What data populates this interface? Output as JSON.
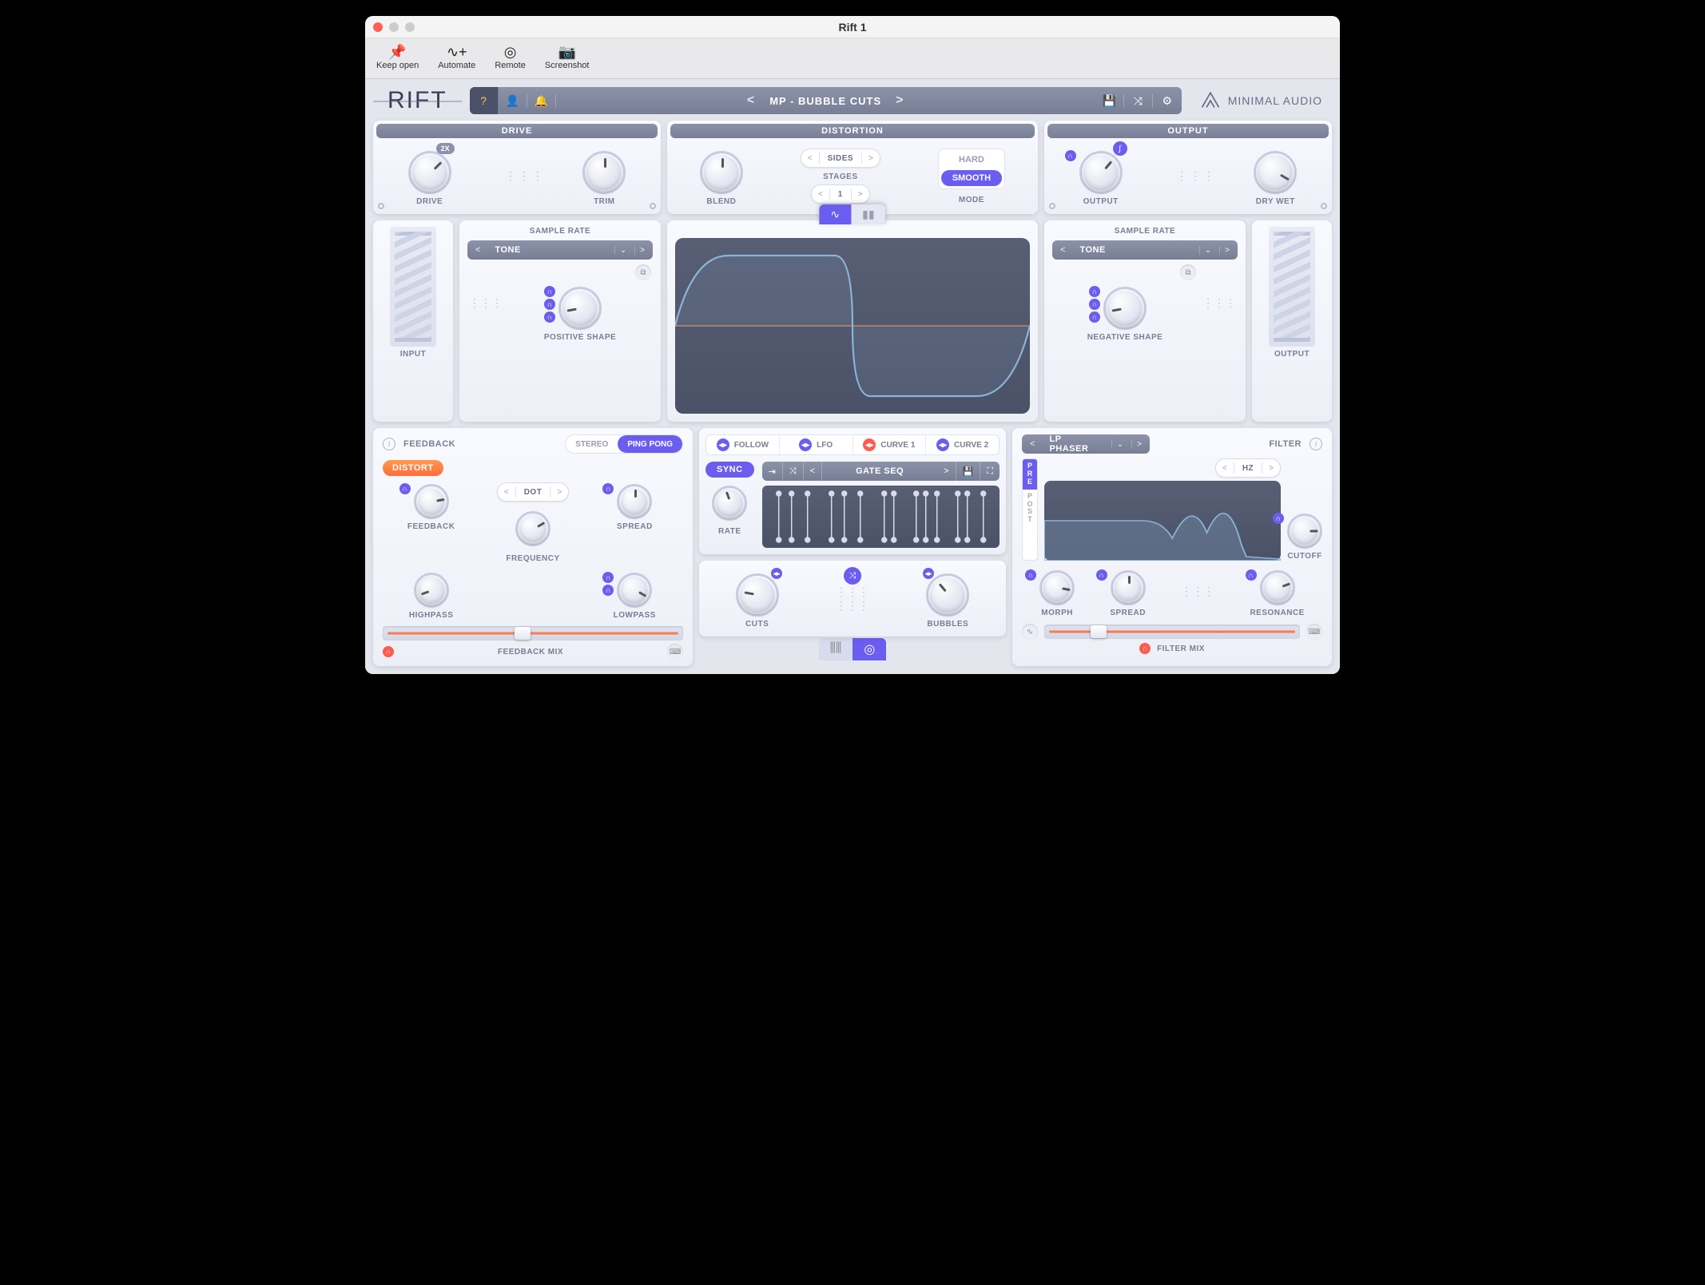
{
  "window": {
    "title": "Rift 1"
  },
  "host_toolbar": {
    "keep_open": "Keep open",
    "automate": "Automate",
    "remote": "Remote",
    "screenshot": "Screenshot"
  },
  "logo_text": "RIFT",
  "preset": {
    "name": "MP - BUBBLE CUTS"
  },
  "brand": "MINIMAL AUDIO",
  "drive": {
    "header": "DRIVE",
    "drive_label": "DRIVE",
    "drive_badge": "2X",
    "trim_label": "TRIM"
  },
  "distortion": {
    "header": "DISTORTION",
    "blend_label": "BLEND",
    "sides_label": "SIDES",
    "stages_label": "STAGES",
    "stages_value": "1",
    "mode_label": "MODE",
    "mode_hard": "HARD",
    "mode_smooth": "SMOOTH"
  },
  "output": {
    "header": "OUTPUT",
    "output_label": "OUTPUT",
    "drywet_label": "DRY WET"
  },
  "input_meter_label": "INPUT",
  "output_meter_label": "OUTPUT",
  "samplerate_left": {
    "header": "SAMPLE RATE",
    "dropdown": "TONE",
    "shape_label": "POSITIVE SHAPE"
  },
  "samplerate_right": {
    "header": "SAMPLE RATE",
    "dropdown": "TONE",
    "shape_label": "NEGATIVE SHAPE"
  },
  "feedback": {
    "header": "FEEDBACK",
    "stereo": "STEREO",
    "pingpong": "PING PONG",
    "distort": "DISTORT",
    "dot": "DOT",
    "feedback_label": "FEEDBACK",
    "spread_label": "SPREAD",
    "frequency_label": "FREQUENCY",
    "highpass_label": "HIGHPASS",
    "lowpass_label": "LOWPASS",
    "mix_label": "FEEDBACK MIX"
  },
  "mod": {
    "follow": "FOLLOW",
    "lfo": "LFO",
    "curve1": "CURVE 1",
    "curve2": "CURVE 2",
    "sync": "SYNC",
    "gateseq": "GATE SEQ",
    "rate_label": "RATE",
    "cuts_label": "CUTS",
    "bubbles_label": "BUBBLES"
  },
  "filter": {
    "header": "FILTER",
    "dropdown": "LP PHASER",
    "hz": "HZ",
    "pre": "P\nR\nE",
    "post": "P\nO\nS\nT",
    "cutoff_label": "CUTOFF",
    "morph_label": "MORPH",
    "spread_label": "SPREAD",
    "resonance_label": "RESONANCE",
    "mix_label": "FILTER MIX"
  }
}
